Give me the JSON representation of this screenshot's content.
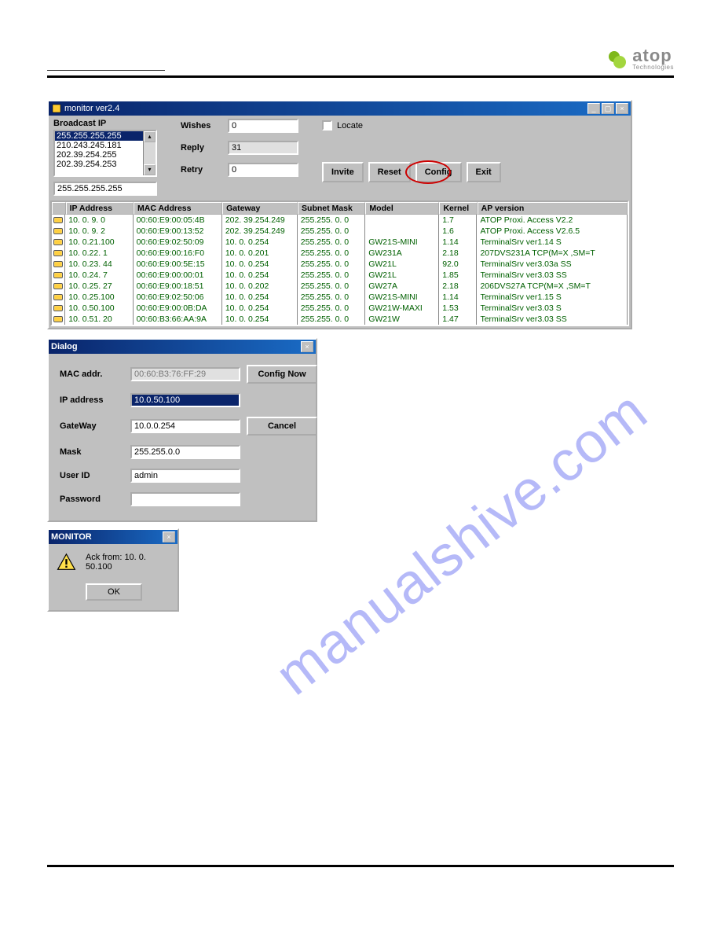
{
  "logo": {
    "brand": "atop",
    "sub": "Technologies"
  },
  "monitor": {
    "title": "monitor ver2.4",
    "broadcast_label": "Broadcast IP",
    "broadcast_items": [
      "255.255.255.255",
      "210.243.245.181",
      "202.39.254.255",
      "202.39.254.253"
    ],
    "broadcast_selected_index": 0,
    "broadcast_input": "255.255.255.255",
    "wishes_label": "Wishes",
    "wishes_value": "0",
    "reply_label": "Reply",
    "reply_value": "31",
    "retry_label": "Retry",
    "retry_value": "0",
    "locate_label": "Locate",
    "buttons": {
      "invite": "Invite",
      "reset": "Reset",
      "config": "Config",
      "exit": "Exit"
    },
    "columns": {
      "ip": "IP Address",
      "mac": "MAC Address",
      "gateway": "Gateway",
      "mask": "Subnet Mask",
      "model": "Model",
      "kernel": "Kernel",
      "ap": "AP version"
    },
    "rows": [
      {
        "ip": "10. 0. 9. 0",
        "mac": "00:60:E9:00:05:4B",
        "gw": "202. 39.254.249",
        "mask": "255.255. 0. 0",
        "model": "",
        "kernel": "1.7",
        "ap": "ATOP Proxi. Access V2.2"
      },
      {
        "ip": "10. 0. 9. 2",
        "mac": "00:60:E9:00:13:52",
        "gw": "202. 39.254.249",
        "mask": "255.255. 0. 0",
        "model": "",
        "kernel": "1.6",
        "ap": "ATOP Proxi. Access V2.6.5"
      },
      {
        "ip": "10. 0.21.100",
        "mac": "00:60:E9:02:50:09",
        "gw": "10. 0. 0.254",
        "mask": "255.255. 0. 0",
        "model": "GW21S-MINI",
        "kernel": "1.14",
        "ap": "TerminalSrv ver1.14 S"
      },
      {
        "ip": "10. 0.22. 1",
        "mac": "00:60:E9:00:16:F0",
        "gw": "10. 0. 0.201",
        "mask": "255.255. 0. 0",
        "model": "GW231A",
        "kernel": "2.18",
        "ap": "207DVS231A TCP(M=X ,SM=T"
      },
      {
        "ip": "10. 0.23. 44",
        "mac": "00:60:E9:00:5E:15",
        "gw": "10. 0. 0.254",
        "mask": "255.255. 0. 0",
        "model": "GW21L",
        "kernel": "92.0",
        "ap": "TerminalSrv ver3.03a   SS"
      },
      {
        "ip": "10. 0.24. 7",
        "mac": "00:60:E9:00:00:01",
        "gw": "10. 0. 0.254",
        "mask": "255.255. 0. 0",
        "model": "GW21L",
        "kernel": "1.85",
        "ap": "TerminalSrv ver3.03   SS"
      },
      {
        "ip": "10. 0.25. 27",
        "mac": "00:60:E9:00:18:51",
        "gw": "10. 0. 0.202",
        "mask": "255.255. 0. 0",
        "model": "GW27A",
        "kernel": "2.18",
        "ap": "206DVS27A TCP(M=X ,SM=T"
      },
      {
        "ip": "10. 0.25.100",
        "mac": "00:60:E9:02:50:06",
        "gw": "10. 0. 0.254",
        "mask": "255.255. 0. 0",
        "model": "GW21S-MINI",
        "kernel": "1.14",
        "ap": "TerminalSrv ver1.15 S"
      },
      {
        "ip": "10. 0.50.100",
        "mac": "00:60:E9:00:0B:DA",
        "gw": "10. 0. 0.254",
        "mask": "255.255. 0. 0",
        "model": "GW21W-MAXI",
        "kernel": "1.53",
        "ap": "TerminalSrv ver3.03   S"
      },
      {
        "ip": "10. 0.51. 20",
        "mac": "00:60:B3:66:AA:9A",
        "gw": "10. 0. 0.254",
        "mask": "255.255. 0. 0",
        "model": "GW21W",
        "kernel": "1.47",
        "ap": "TerminalSrv ver3.03   SS"
      }
    ]
  },
  "dialog": {
    "title": "Dialog",
    "labels": {
      "mac": "MAC addr.",
      "ip": "IP address",
      "gateway": "GateWay",
      "mask": "Mask",
      "user": "User ID",
      "password": "Password"
    },
    "values": {
      "mac": "00:60:B3:76:FF:29",
      "ip": "10.0.50.100",
      "gateway": "10.0.0.254",
      "mask": "255.255.0.0",
      "user": "admin",
      "password": ""
    },
    "buttons": {
      "config_now": "Config Now",
      "cancel": "Cancel"
    }
  },
  "ack": {
    "title": "MONITOR",
    "message": "Ack from:  10.  0. 50.100",
    "ok": "OK"
  },
  "watermark": "manualshive.com"
}
